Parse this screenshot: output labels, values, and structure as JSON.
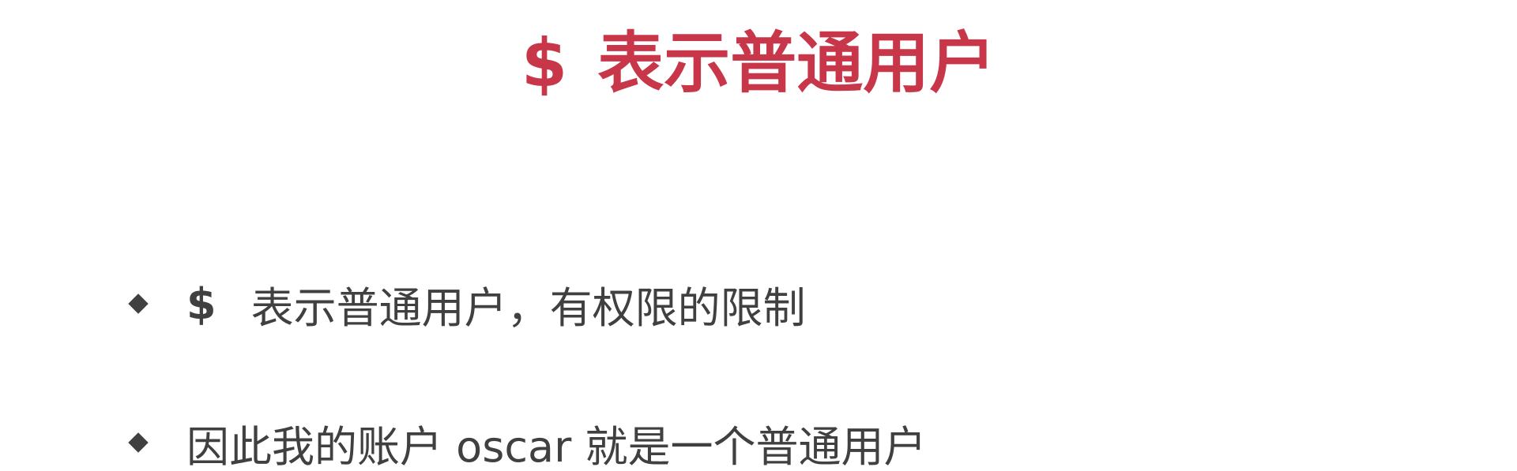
{
  "slide": {
    "title_symbol": "$",
    "title_text": "表示普通用户",
    "bullets": [
      {
        "symbol": "$",
        "text": "表示普通用户，有权限的限制"
      },
      {
        "text": "因此我的账户 oscar 就是一个普通用户"
      }
    ],
    "colors": {
      "title": "#c8364a",
      "body": "#404040",
      "background": "#ffffff"
    },
    "bullet_icon": "diamond-bullet-icon"
  }
}
